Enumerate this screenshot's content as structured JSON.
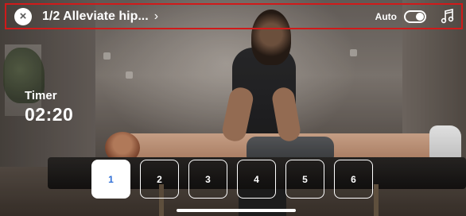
{
  "header": {
    "title": "1/2 Alleviate hip...",
    "chevron": "›",
    "close_icon": "×",
    "auto_label": "Auto",
    "auto_enabled": true,
    "music_icon": "music-playlist-icon"
  },
  "timer": {
    "label": "Timer",
    "value": "02:20"
  },
  "steps": [
    {
      "label": "1",
      "active": true
    },
    {
      "label": "2",
      "active": false
    },
    {
      "label": "3",
      "active": false
    },
    {
      "label": "4",
      "active": false
    },
    {
      "label": "5",
      "active": false
    },
    {
      "label": "6",
      "active": false
    }
  ],
  "colors": {
    "highlight_border": "#d01a1a",
    "active_step_text": "#2f6fd6"
  }
}
